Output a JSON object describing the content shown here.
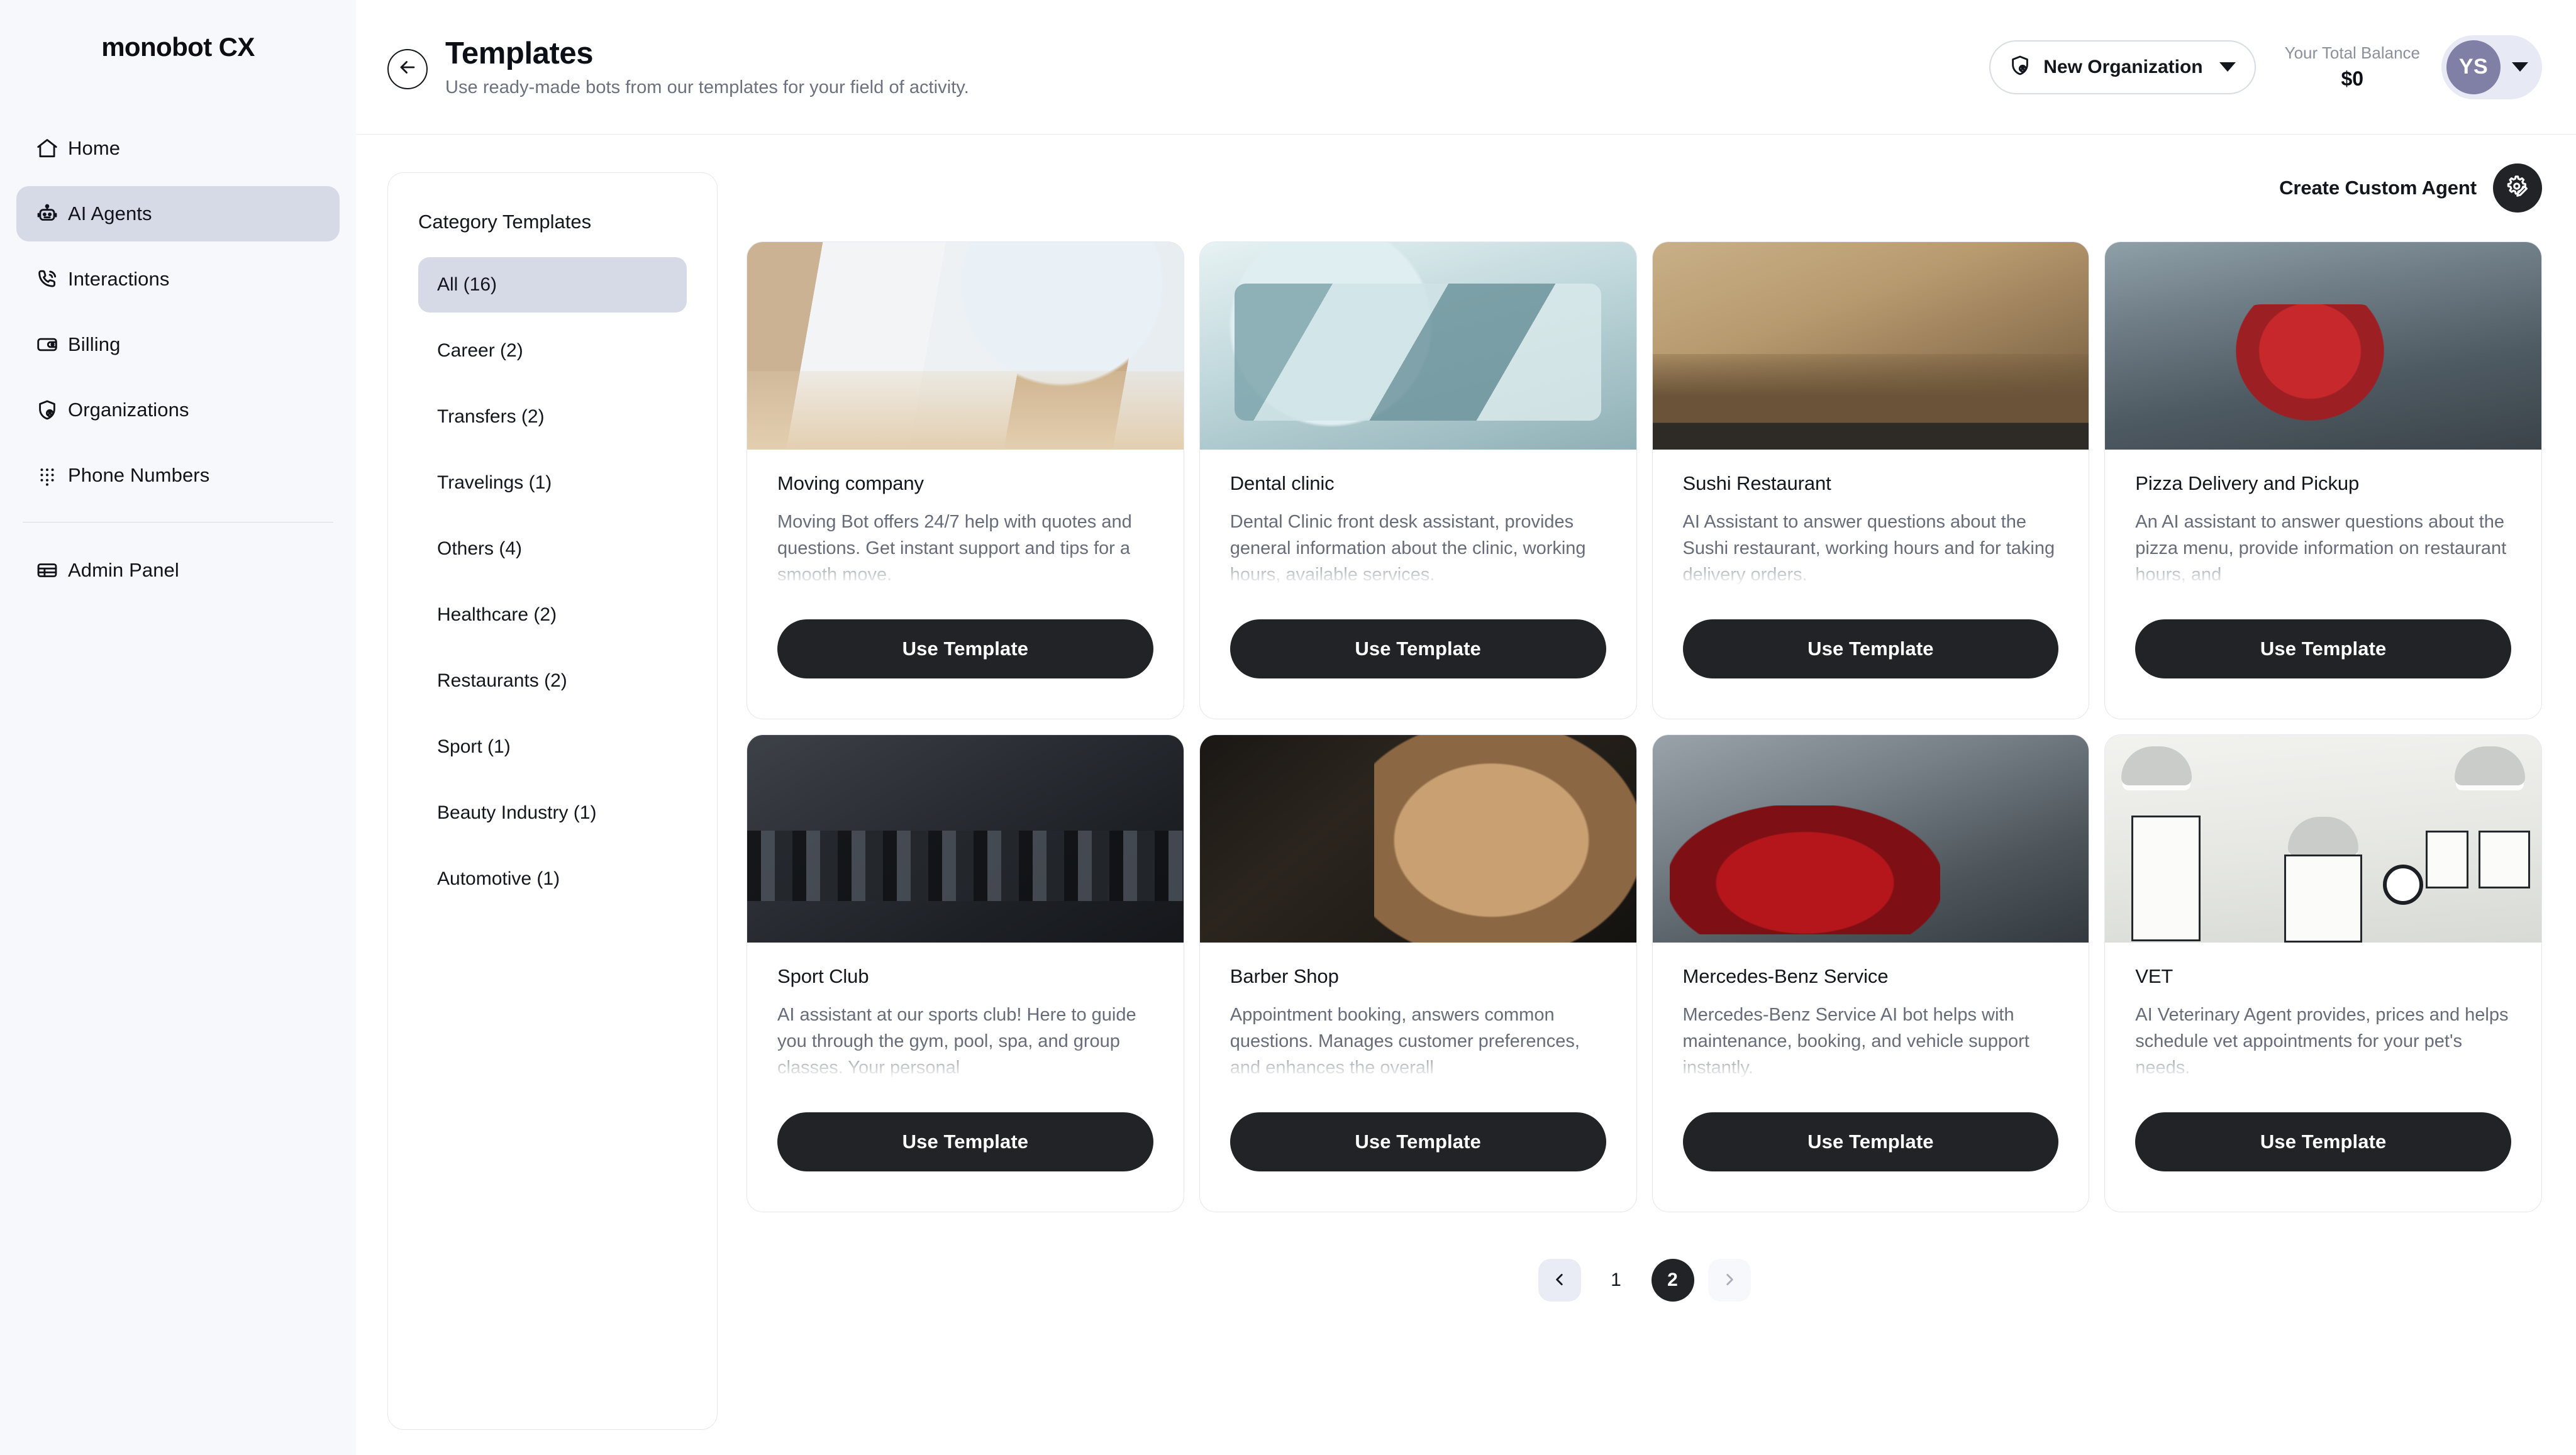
{
  "brand": {
    "name": "monobot CX"
  },
  "sidebar": {
    "items": [
      {
        "label": "Home",
        "icon": "home-icon",
        "active": false
      },
      {
        "label": "AI Agents",
        "icon": "robot-icon",
        "active": true
      },
      {
        "label": "Interactions",
        "icon": "phone-call-icon",
        "active": false
      },
      {
        "label": "Billing",
        "icon": "wallet-icon",
        "active": false
      },
      {
        "label": "Organizations",
        "icon": "shield-user-icon",
        "active": false
      },
      {
        "label": "Phone Numbers",
        "icon": "dialpad-icon",
        "active": false
      }
    ],
    "footer_items": [
      {
        "label": "Admin Panel",
        "icon": "table-icon",
        "active": false
      }
    ]
  },
  "header": {
    "title": "Templates",
    "subtitle": "Use ready-made bots from our templates for your field of activity.",
    "back_icon": "arrow-left-icon",
    "organization": {
      "label": "New Organization",
      "icon": "shield-user-icon"
    },
    "balance": {
      "label": "Your Total Balance",
      "value": "$0"
    },
    "user": {
      "initials": "YS"
    }
  },
  "categories": {
    "title": "Category Templates",
    "items": [
      {
        "label": "All (16)",
        "active": true
      },
      {
        "label": "Career (2)",
        "active": false
      },
      {
        "label": "Transfers (2)",
        "active": false
      },
      {
        "label": "Travelings (1)",
        "active": false
      },
      {
        "label": "Others (4)",
        "active": false
      },
      {
        "label": "Healthcare (2)",
        "active": false
      },
      {
        "label": "Restaurants (2)",
        "active": false
      },
      {
        "label": "Sport (1)",
        "active": false
      },
      {
        "label": "Beauty Industry (1)",
        "active": false
      },
      {
        "label": "Automotive (1)",
        "active": false
      }
    ]
  },
  "create_custom_agent": {
    "label": "Create Custom Agent",
    "icon": "gear-pencil-icon"
  },
  "cards": [
    {
      "name": "Moving company",
      "description": "Moving Bot offers 24/7 help with quotes and questions. Get instant support and tips for a smooth move.",
      "button": "Use Template",
      "image": "movers-packing-boxes-photo",
      "image_class": "ph-moving"
    },
    {
      "name": "Dental clinic",
      "description": "Dental Clinic front desk assistant, provides general information about the clinic, working hours, available services.",
      "button": "Use Template",
      "image": "dentists-treating-patient-photo",
      "image_class": "ph-dental"
    },
    {
      "name": "Sushi Restaurant",
      "description": "AI Assistant to answer questions about the Sushi restaurant, working hours and for taking delivery orders.",
      "button": "Use Template",
      "image": "sushi-bar-chef-and-guests-photo",
      "image_class": "ph-sushi"
    },
    {
      "name": "Pizza Delivery and Pickup",
      "description": "An AI assistant to answer questions about the pizza menu, provide information on restaurant hours, and",
      "button": "Use Template",
      "image": "pizza-courier-on-street-photo",
      "image_class": "ph-pizza"
    },
    {
      "name": "Sport Club",
      "description": "AI assistant at our sports club! Here to guide you through the gym, pool, spa, and group classes. Your personal",
      "button": "Use Template",
      "image": "gym-dumbbell-rack-photo",
      "image_class": "ph-sport"
    },
    {
      "name": "Barber Shop",
      "description": "Appointment booking, answers common questions. Manages customer preferences, and enhances the overall",
      "button": "Use Template",
      "image": "barber-trimming-hair-photo",
      "image_class": "ph-barber"
    },
    {
      "name": "Mercedes-Benz Service",
      "description": "Mercedes-Benz Service AI bot helps with maintenance, booking, and vehicle support instantly.",
      "button": "Use Template",
      "image": "classic-red-car-in-garage-photo",
      "image_class": "ph-mercedes"
    },
    {
      "name": "VET",
      "description": "AI Veterinary Agent provides, prices and helps schedule vet appointments for your pet's needs.",
      "button": "Use Template",
      "image": "veterinary-clinic-room-photo",
      "image_class": "ph-vet"
    }
  ],
  "pagination": {
    "prev_icon": "chevron-left-icon",
    "next_icon": "chevron-right-icon",
    "pages": [
      {
        "label": "1",
        "active": false
      },
      {
        "label": "2",
        "active": true
      }
    ]
  },
  "colors": {
    "accent_dark": "#222326",
    "sidebar_bg": "#f7f8fc",
    "active_item": "#d5dae6",
    "avatar": "#807fa5",
    "muted_text": "#6c7180"
  }
}
